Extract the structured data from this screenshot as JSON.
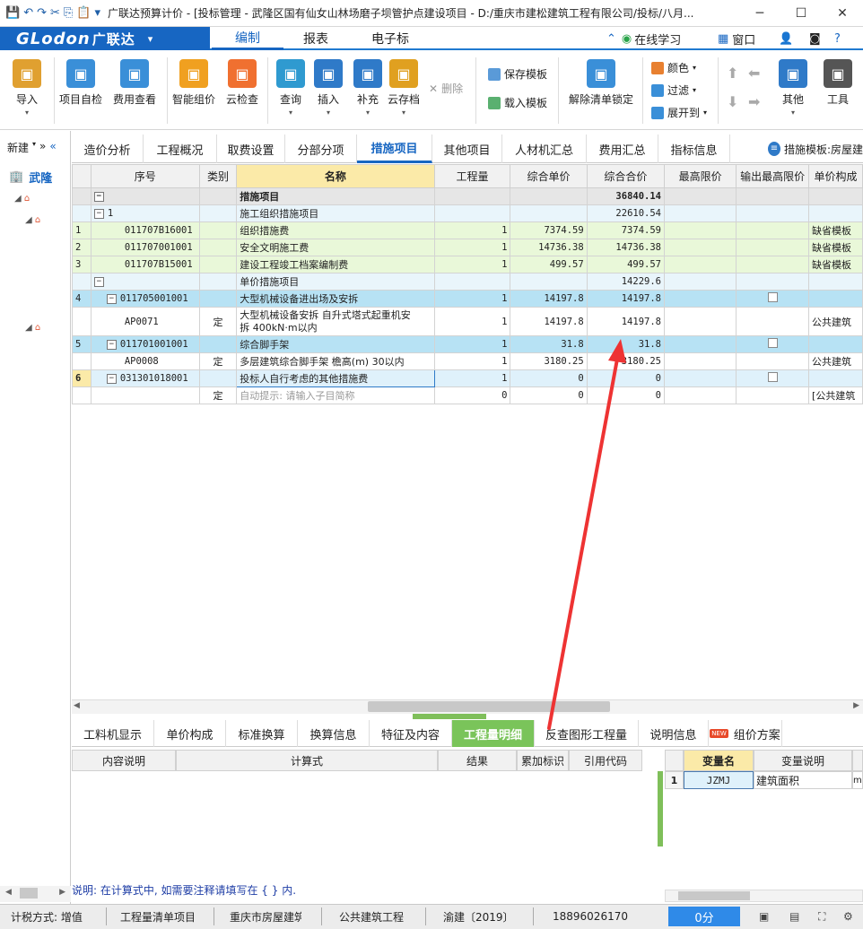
{
  "title_bar": {
    "title": "广联达预算计价 - [投标管理 - 武隆区国有仙女山林场磨子坝管护点建设项目 - D:/重庆市建松建筑工程有限公司/投标/八月...",
    "minimize": "─",
    "maximize": "☐",
    "close": "✕"
  },
  "menu": {
    "logo_text": "GLodon",
    "logo_cn": "广联达",
    "logo_dropdown": "▾",
    "tabs": [
      "编制",
      "报表",
      "电子标"
    ],
    "online_learning": "在线学习",
    "window": "窗口",
    "help": "?"
  },
  "ribbon": {
    "buttons": [
      {
        "label": "导入",
        "icon": "import-icon",
        "color": "#e0a030"
      },
      {
        "label": "项目自检",
        "icon": "self-check-icon",
        "color": "#3a8fd8"
      },
      {
        "label": "费用查看",
        "icon": "fee-view-icon",
        "color": "#3a8fd8"
      },
      {
        "label": "智能组价",
        "icon": "smart-price-icon",
        "color": "#f0a020"
      },
      {
        "label": "云检查",
        "icon": "cloud-check-icon",
        "color": "#f07030"
      },
      {
        "label": "查询",
        "icon": "query-icon",
        "color": "#2f9ad0"
      },
      {
        "label": "插入",
        "icon": "insert-icon",
        "color": "#2f7ac8"
      },
      {
        "label": "补充",
        "icon": "supplement-icon",
        "color": "#2f7ac8"
      },
      {
        "label": "云存档",
        "icon": "cloud-save-icon",
        "color": "#e0a020"
      },
      {
        "label": "解除清单锁定",
        "icon": "unlock-icon",
        "color": "#3a8fd8"
      },
      {
        "label": "其他",
        "icon": "other-icon",
        "color": "#2f7ac8"
      },
      {
        "label": "工具",
        "icon": "tools-icon",
        "color": "#555555"
      }
    ],
    "delete_label": "删除",
    "save_template": "保存模板",
    "load_template": "载入模板",
    "color_label": "颜色",
    "filter_label": "过滤",
    "expand_label": "展开到"
  },
  "left_panel": {
    "new_label": "新建",
    "collapse": "»",
    "root_label": "武隆"
  },
  "view_tabs": [
    "造价分析",
    "工程概况",
    "取费设置",
    "分部分项",
    "措施项目",
    "其他项目",
    "人材机汇总",
    "费用汇总",
    "指标信息"
  ],
  "active_view_tab": "措施项目",
  "template_label": "措施模板:房屋建",
  "grid": {
    "columns": [
      "",
      "序号",
      "类别",
      "名称",
      "工程量",
      "综合单价",
      "综合合价",
      "最高限价",
      "输出最高限价",
      "单价构成"
    ],
    "rows": [
      {
        "style": "head",
        "no": "",
        "code": "",
        "toggle": "−",
        "cat": "",
        "name": "措施项目",
        "qty": "",
        "price": "",
        "total": "36840.14",
        "max": "",
        "out": false,
        "comp": ""
      },
      {
        "style": "sec",
        "no": "",
        "code": "1",
        "toggle": "−",
        "cat": "",
        "name": "施工组织措施项目",
        "qty": "",
        "price": "",
        "total": "22610.54",
        "max": "",
        "out": false,
        "comp": ""
      },
      {
        "style": "g",
        "no": "1",
        "code": "011707B16001",
        "toggle": "",
        "cat": "",
        "name": "组织措施费",
        "qty": "1",
        "price": "7374.59",
        "total": "7374.59",
        "max": "",
        "out": false,
        "comp": "缺省模板"
      },
      {
        "style": "g",
        "no": "2",
        "code": "011707001001",
        "toggle": "",
        "cat": "",
        "name": "安全文明施工费",
        "qty": "1",
        "price": "14736.38",
        "total": "14736.38",
        "max": "",
        "out": false,
        "comp": "缺省模板"
      },
      {
        "style": "g",
        "no": "3",
        "code": "011707B15001",
        "toggle": "",
        "cat": "",
        "name": "建设工程竣工档案编制费",
        "qty": "1",
        "price": "499.57",
        "total": "499.57",
        "max": "",
        "out": false,
        "comp": "缺省模板"
      },
      {
        "style": "sec",
        "no": "",
        "code": "",
        "toggle": "−",
        "cat": "",
        "name": "单价措施项目",
        "qty": "",
        "price": "",
        "total": "14229.6",
        "max": "",
        "out": false,
        "comp": ""
      },
      {
        "style": "b",
        "no": "4",
        "code": "011705001001",
        "toggle": "−",
        "cat": "",
        "name": "大型机械设备进出场及安拆",
        "qty": "1",
        "price": "14197.8",
        "total": "14197.8",
        "max": "",
        "out": true,
        "comp": ""
      },
      {
        "style": "w2",
        "no": "",
        "code": "AP0071",
        "toggle": "",
        "cat": "定",
        "name": "大型机械设备安拆 自升式塔式起重机安",
        "name2": "拆 400kN·m以内",
        "qty": "1",
        "price": "14197.8",
        "total": "14197.8",
        "max": "",
        "out": false,
        "comp": "公共建筑"
      },
      {
        "style": "b",
        "no": "5",
        "code": "011701001001",
        "toggle": "−",
        "cat": "",
        "name": "综合脚手架",
        "qty": "1",
        "price": "31.8",
        "total": "31.8",
        "max": "",
        "out": true,
        "comp": ""
      },
      {
        "style": "w",
        "no": "",
        "code": "AP0008",
        "toggle": "",
        "cat": "定",
        "name": "多层建筑综合脚手架 檐高(m) 30以内",
        "qty": "1",
        "price": "3180.25",
        "total": "3180.25",
        "max": "",
        "out": false,
        "comp": "公共建筑"
      },
      {
        "style": "sel",
        "no": "6",
        "code": "031301018001",
        "toggle": "−",
        "cat": "",
        "name": "投标人自行考虑的其他措施费",
        "qty": "1",
        "price": "0",
        "total": "0",
        "max": "",
        "out": true,
        "comp": ""
      },
      {
        "style": "w",
        "no": "",
        "code": "",
        "toggle": "",
        "cat": "定",
        "name": "自动提示: 请输入子目简称",
        "qty": "0",
        "price": "0",
        "total": "0",
        "max": "",
        "out": false,
        "comp": "[公共建筑"
      }
    ]
  },
  "bottom_tabs": [
    "工料机显示",
    "单价构成",
    "标准换算",
    "换算信息",
    "特征及内容",
    "工程量明细",
    "反查图形工程量",
    "说明信息",
    "组价方案"
  ],
  "active_bottom_tab": "工程量明细",
  "new_badge": "NEW",
  "detail_columns": [
    "内容说明",
    "计算式",
    "结果",
    "累加标识",
    "引用代码"
  ],
  "var_columns": [
    "变量名",
    "变量说明"
  ],
  "var_rows": [
    {
      "no": "1",
      "name": "JZMJ",
      "desc": "建筑面积",
      "extra": "m"
    }
  ],
  "hint": "说明: 在计算式中, 如需要注释请填写在 { } 内.",
  "status": {
    "tax": "计税方式: 增值",
    "list": "工程量清单项目",
    "region": "重庆市房屋建筑",
    "type": "公共建筑工程",
    "std": "渝建〔2019〕",
    "phone": "18896026170",
    "score": "0分"
  }
}
